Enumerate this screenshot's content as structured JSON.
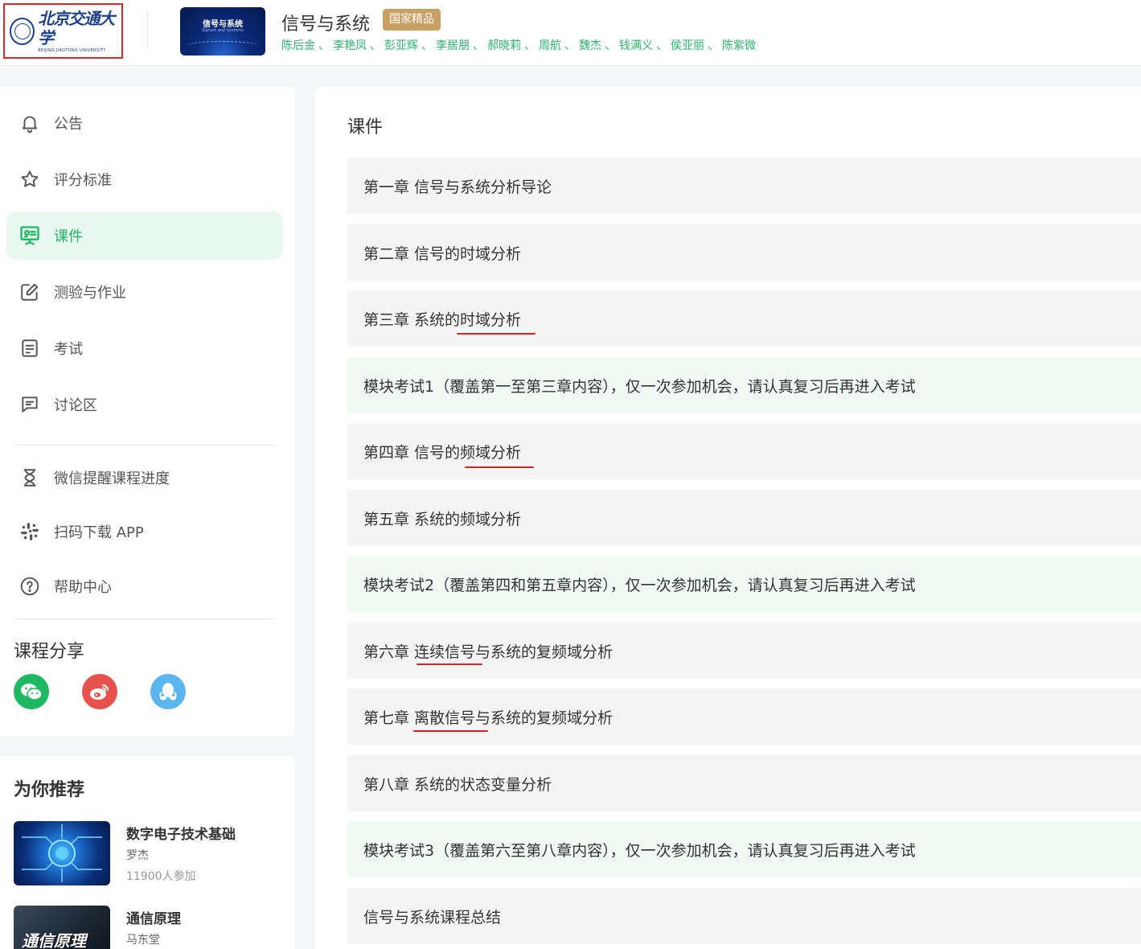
{
  "header": {
    "university_logo_text": "北京交通大学",
    "university_logo_en": "BEIJING JIAOTONG UNIVERSITY",
    "thumbnail_title": "信号与系统",
    "thumbnail_subtitle": "Signals and Systems",
    "course_title": "信号与系统",
    "badge": "国家精品",
    "teachers": [
      "陈后金",
      "李艳凤",
      "彭亚辉",
      "李居朋",
      "郝晓莉",
      "周航",
      "魏杰",
      "钱满义",
      "侯亚丽",
      "陈紫微"
    ],
    "teacher_separator": "、"
  },
  "sidebar": {
    "items": [
      {
        "label": "公告",
        "icon": "bell-icon"
      },
      {
        "label": "评分标准",
        "icon": "star-icon"
      },
      {
        "label": "课件",
        "icon": "presentation-icon",
        "active": true
      },
      {
        "label": "测验与作业",
        "icon": "edit-icon"
      },
      {
        "label": "考试",
        "icon": "document-icon"
      },
      {
        "label": "讨论区",
        "icon": "chat-icon"
      }
    ],
    "extra_items": [
      {
        "label": "微信提醒课程进度",
        "icon": "hourglass-icon"
      },
      {
        "label": "扫码下载 APP",
        "icon": "app-icon"
      },
      {
        "label": "帮助中心",
        "icon": "help-icon"
      }
    ],
    "share_title": "课程分享",
    "share": [
      "wechat-icon",
      "weibo-icon",
      "qq-icon"
    ]
  },
  "recommend": {
    "title": "为你推荐",
    "items": [
      {
        "name": "数字电子技术基础",
        "teacher": "罗杰",
        "count": "11900人参加"
      },
      {
        "name": "通信原理",
        "teacher": "马东堂",
        "count": "",
        "image_text": "通信原理"
      }
    ]
  },
  "main": {
    "title": "课件",
    "rows": [
      {
        "label": "第一章 信号与系统分析导论",
        "type": "chapter"
      },
      {
        "label": "第二章 信号的时域分析",
        "type": "chapter"
      },
      {
        "label": "第三章 系统的时域分析",
        "type": "chapter"
      },
      {
        "label": "模块考试1（覆盖第一至第三章内容），仅一次参加机会，请认真复习后再进入考试",
        "type": "exam"
      },
      {
        "label": "第四章 信号的频域分析",
        "type": "chapter"
      },
      {
        "label": "第五章 系统的频域分析",
        "type": "chapter"
      },
      {
        "label": "模块考试2（覆盖第四和第五章内容），仅一次参加机会，请认真复习后再进入考试",
        "type": "exam"
      },
      {
        "label": "第六章 连续信号与系统的复频域分析",
        "type": "chapter"
      },
      {
        "label": "第七章 离散信号与系统的复频域分析",
        "type": "chapter"
      },
      {
        "label": "第八章 系统的状态变量分析",
        "type": "chapter"
      },
      {
        "label": "模块考试3（覆盖第六至第八章内容），仅一次参加机会，请认真复习后再进入考试",
        "type": "exam"
      },
      {
        "label": "信号与系统课程总结",
        "type": "chapter"
      }
    ]
  },
  "colors": {
    "accent_green": "#1fb862",
    "badge_gold": "#c9a063",
    "annotation_red": "#e02020",
    "logo_box_red": "#d9262b"
  }
}
